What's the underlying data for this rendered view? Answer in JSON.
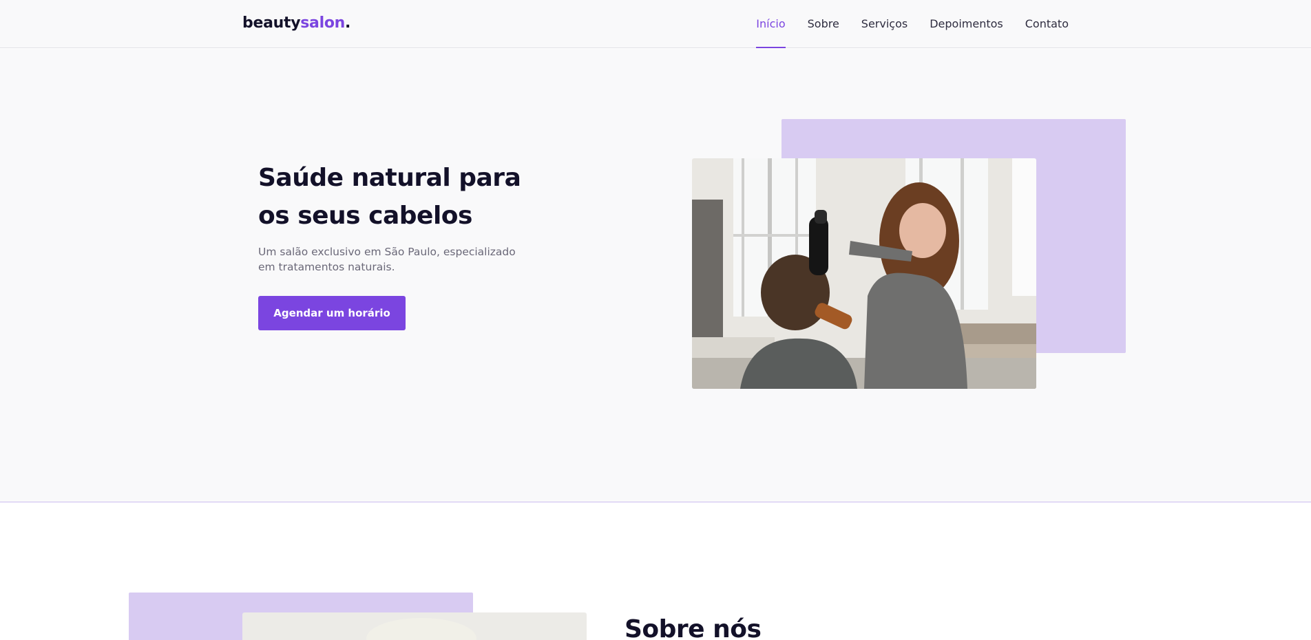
{
  "header": {
    "logo": {
      "main": "beauty",
      "accent": "salon",
      "dot": "."
    },
    "nav": [
      {
        "label": "Início",
        "active": true
      },
      {
        "label": "Sobre",
        "active": false
      },
      {
        "label": "Serviços",
        "active": false
      },
      {
        "label": "Depoimentos",
        "active": false
      },
      {
        "label": "Contato",
        "active": false
      }
    ]
  },
  "hero": {
    "title": "Saúde natural para os seus cabelos",
    "subtitle": "Um salão exclusivo em São Paulo, especializado em tratamentos naturais.",
    "cta_label": "Agendar um horário",
    "image_icon": "hairdresser-photo"
  },
  "about": {
    "title": "Sobre nós"
  },
  "colors": {
    "brand": "#7b45e0",
    "accent_block": "#d8cbf2",
    "heading": "#131129",
    "body_text": "#6a6878",
    "hero_bg": "#f9f9fa"
  }
}
